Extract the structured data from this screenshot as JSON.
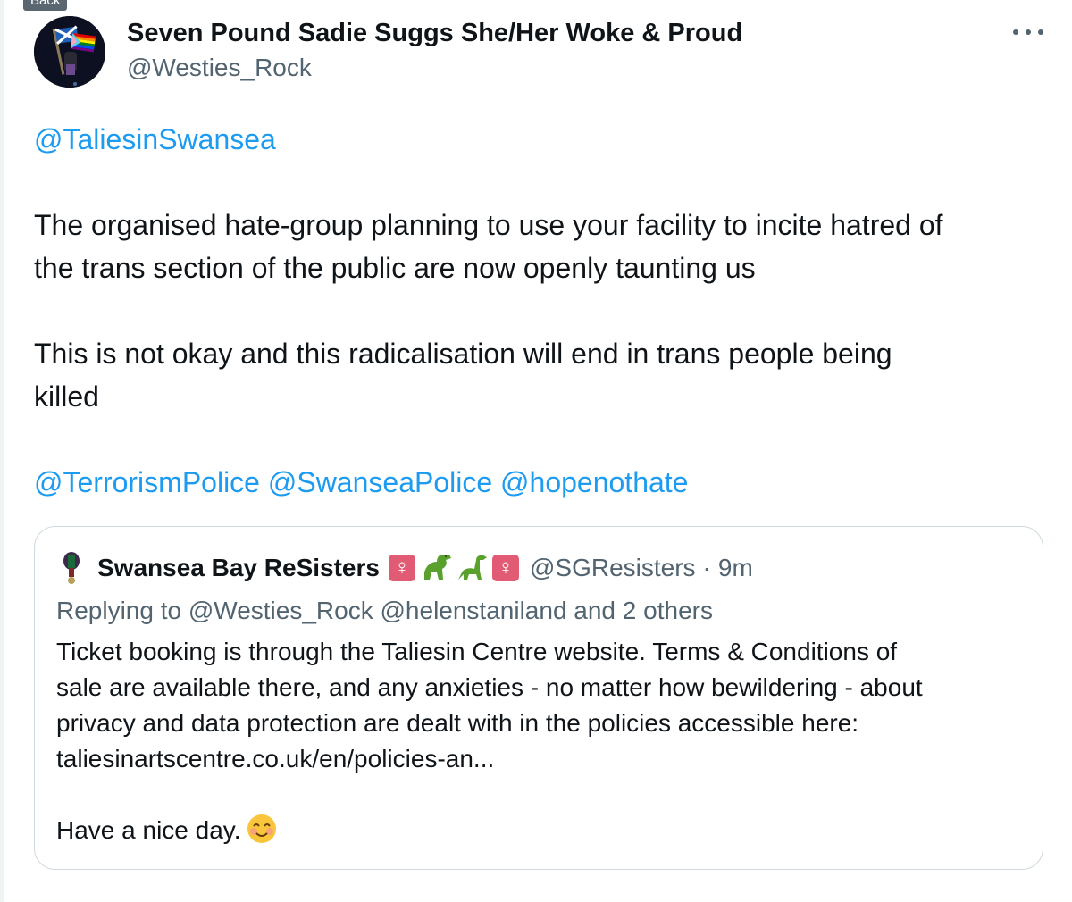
{
  "nav": {
    "back_label": "Back"
  },
  "tweet": {
    "author_name": "Seven Pound Sadie Suggs She/Her Woke & Proud",
    "author_handle": "@Westies_Rock",
    "more_icon": "ellipsis-icon",
    "mention_top": "@TaliesinSwansea",
    "paragraph1_line1": "The organised hate-group planning to use your facility to incite hatred of",
    "paragraph1_line2": "the trans section of the public are now openly taunting us",
    "paragraph2_line1": "This is not okay and this radicalisation will end in trans people being",
    "paragraph2_line2": "killed",
    "mentions_bottom": [
      "@TerrorismPolice",
      "@SwanseaPolice",
      "@hopenothate"
    ]
  },
  "quote": {
    "author_name": "Swansea Bay ReSisters",
    "name_emojis": [
      "venus-badge",
      "t-rex-icon",
      "sauropod-icon",
      "venus-badge"
    ],
    "venus_symbol": "♀",
    "author_handle": "@SGResisters",
    "separator": "·",
    "time": "9m",
    "replying_to": "Replying to @Westies_Rock @helenstaniland and 2 others",
    "line1": "Ticket booking is through the Taliesin Centre website. Terms & Conditions of",
    "line2": "sale are available there, and any anxieties - no matter how bewildering - about",
    "line3": "privacy and data protection are dealt with in the policies accessible here:",
    "line4": "taliesinartscentre.co.uk/en/policies-an...",
    "closing": "Have a nice day.",
    "closing_emoji": "smiling-face-icon"
  },
  "colors": {
    "link": "#1d9bf0",
    "secondary_text": "#536471",
    "primary_text": "#0f1419",
    "border": "#cfd9de"
  }
}
